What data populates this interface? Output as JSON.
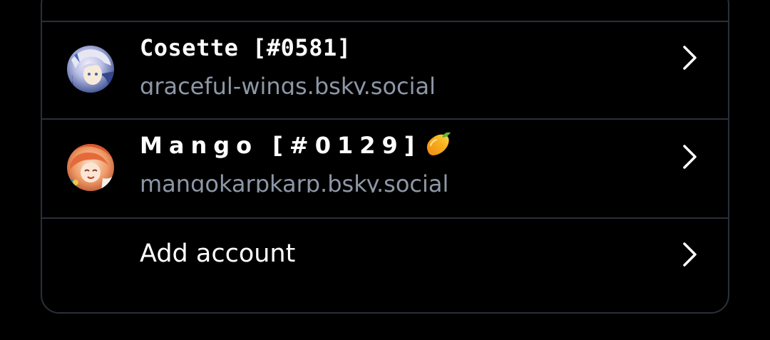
{
  "accounts": [
    {
      "display_name": "Cosette [#0581]",
      "handle": "graceful-wings.bsky.social",
      "avatar": "cosette-avatar"
    },
    {
      "display_name": "Mango [#0129]",
      "handle": "mangokarpkarp.bsky.social",
      "avatar": "mango-avatar",
      "emoji": "mango-emoji-icon"
    }
  ],
  "add_account": {
    "label": "Add account"
  },
  "colors": {
    "background": "#000000",
    "border": "#2a3039",
    "text_primary": "#ffffff",
    "text_secondary": "#8d97a6"
  }
}
